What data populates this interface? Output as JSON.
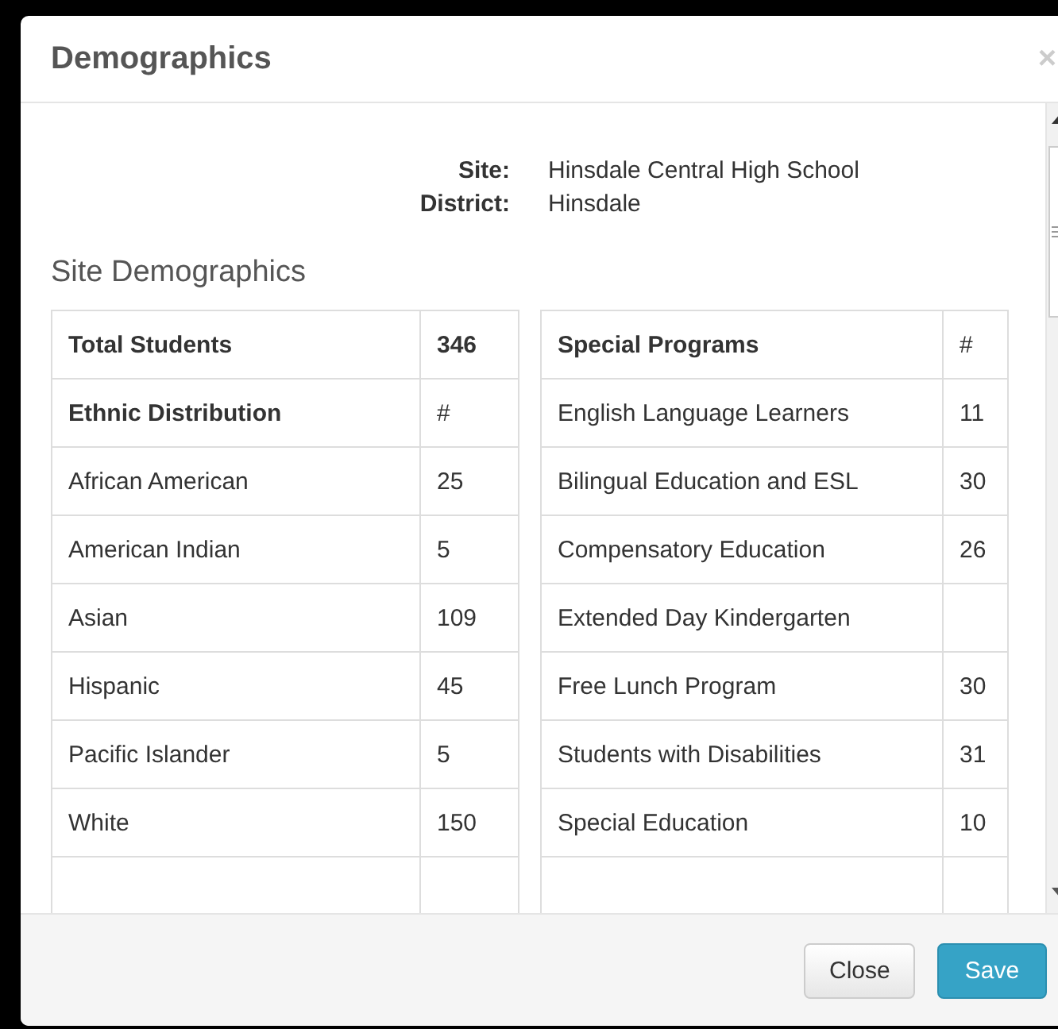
{
  "dialog": {
    "title": "Demographics",
    "close_icon": "×"
  },
  "site_info": [
    {
      "label": "Site:",
      "value": "Hinsdale Central High School"
    },
    {
      "label": "District:",
      "value": "Hinsdale"
    }
  ],
  "section_title": "Site Demographics",
  "ethnic_table": {
    "total": {
      "label": "Total Students",
      "value": "346"
    },
    "header": {
      "label": "Ethnic Distribution",
      "value": "#"
    },
    "rows": [
      {
        "label": "African American",
        "value": "25"
      },
      {
        "label": "American Indian",
        "value": "5"
      },
      {
        "label": "Asian",
        "value": "109"
      },
      {
        "label": "Hispanic",
        "value": "45"
      },
      {
        "label": "Pacific Islander",
        "value": "5"
      },
      {
        "label": "White",
        "value": "150"
      }
    ]
  },
  "programs_table": {
    "header": {
      "label": "Special Programs",
      "value": "#"
    },
    "rows": [
      {
        "label": "English Language Learners",
        "value": "11"
      },
      {
        "label": "Bilingual Education and ESL",
        "value": "30"
      },
      {
        "label": "Compensatory Education",
        "value": "26"
      },
      {
        "label": "Extended Day Kindergarten"
      },
      {
        "label": "Free Lunch Program",
        "value": "30"
      },
      {
        "label": "Students with Disabilities",
        "value": "31"
      },
      {
        "label": "Special Education",
        "value": "10"
      }
    ]
  },
  "buttons": [
    {
      "label": "Close",
      "kind": "default"
    },
    {
      "label": "Save",
      "kind": "primary"
    }
  ]
}
